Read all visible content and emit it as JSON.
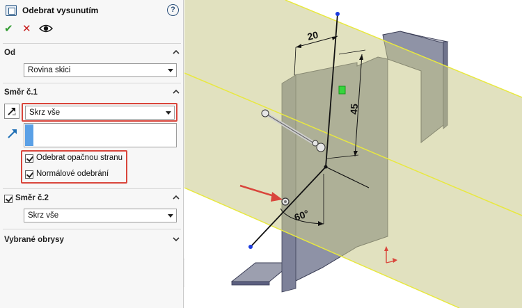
{
  "panel": {
    "title": "Odebrat vysunutím",
    "help_icon": "?",
    "ok_icon": "check-icon",
    "cancel_icon": "close-icon",
    "preview_icon": "eye-icon",
    "from": {
      "header": "Od",
      "value": "Rovina skici"
    },
    "direction1": {
      "header": "Směr č.1",
      "end_condition": "Skrz vše",
      "flip_side_label": "Odebrat opačnou stranu",
      "flip_side_checked": true,
      "normal_cut_label": "Normálové odebrání",
      "normal_cut_checked": true
    },
    "direction2": {
      "header": "Směr č.2",
      "checked": true,
      "end_condition": "Skrz vše"
    },
    "selected_contours": {
      "header": "Vybrané obrysy"
    }
  },
  "viewport": {
    "dim_width": "20",
    "dim_height": "45",
    "dim_angle": "60°",
    "plane_color": "#c9c98a",
    "plane_edge_color": "#e8e840",
    "annotation_color": "#d9453b"
  }
}
